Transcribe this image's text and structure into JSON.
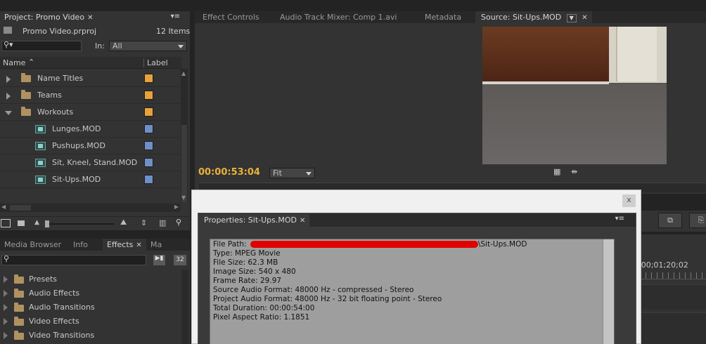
{
  "project": {
    "tab_label": "Project: Promo Video",
    "file_name": "Promo Video.prproj",
    "item_count": "12 Items",
    "in_label": "In:",
    "in_value": "All",
    "col_name": "Name",
    "col_label": "Label",
    "items": [
      {
        "name": "Name Titles",
        "type": "folder",
        "color": "#e8a23a"
      },
      {
        "name": "Teams",
        "type": "folder",
        "color": "#e8a23a"
      },
      {
        "name": "Workouts",
        "type": "folder",
        "color": "#e8a23a"
      },
      {
        "name": "Lunges.MOD",
        "type": "clip",
        "color": "#6f8fc8"
      },
      {
        "name": "Pushups.MOD",
        "type": "clip",
        "color": "#6f8fc8"
      },
      {
        "name": "Sit, Kneel, Stand.MOD",
        "type": "clip",
        "color": "#6f8fc8"
      },
      {
        "name": "Sit-Ups.MOD",
        "type": "clip",
        "color": "#6f8fc8"
      }
    ]
  },
  "effects_tabs": [
    "Media Browser",
    "Info",
    "Effects",
    "Ma"
  ],
  "effects_badge": "32",
  "effects_items": [
    "Presets",
    "Audio Effects",
    "Audio Transitions",
    "Video Effects",
    "Video Transitions"
  ],
  "source_tabs": [
    "Effect Controls",
    "Audio Track Mixer: Comp 1.avi",
    "Metadata",
    "Source: Sit-Ups.MOD"
  ],
  "source": {
    "timecode": "00:00:53:04",
    "fit": "Fit",
    "timeline_tc": ";00;01;20;02"
  },
  "dialog": {
    "title": "Properties: Sit-Ups.MOD",
    "close": "x",
    "file_path_label": "File Path:",
    "file_path_end": "\\Sit-Ups.MOD",
    "lines": [
      "Type: MPEG Movie",
      "File Size: 62.3 MB",
      "Image Size: 540 x 480",
      "Frame Rate: 29.97",
      "Source Audio Format: 48000 Hz - compressed - Stereo",
      "Project Audio Format: 48000 Hz - 32 bit floating point - Stereo",
      "Total Duration: 00:00:54:00",
      "Pixel Aspect Ratio: 1.1851"
    ]
  },
  "colors": {
    "accent": "#e8b23a",
    "redaction": "#e00000"
  }
}
